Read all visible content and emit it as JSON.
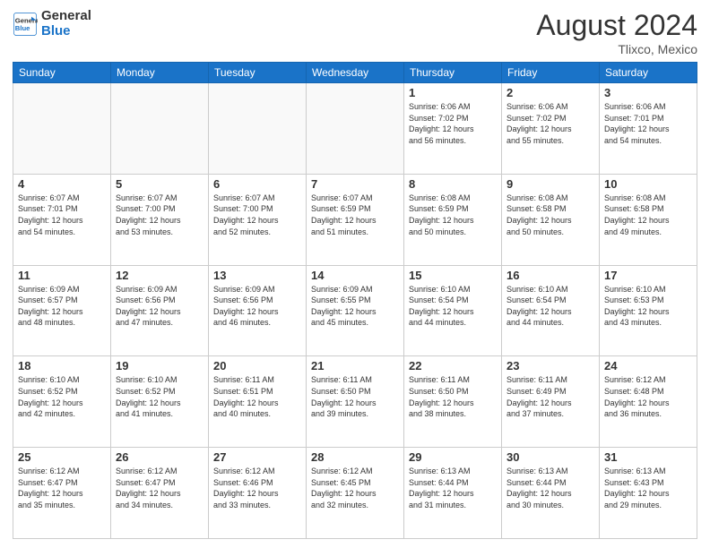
{
  "header": {
    "logo_line1": "General",
    "logo_line2": "Blue",
    "month_title": "August 2024",
    "location": "Tlixco, Mexico"
  },
  "weekdays": [
    "Sunday",
    "Monday",
    "Tuesday",
    "Wednesday",
    "Thursday",
    "Friday",
    "Saturday"
  ],
  "rows": [
    [
      {
        "day": "",
        "info": ""
      },
      {
        "day": "",
        "info": ""
      },
      {
        "day": "",
        "info": ""
      },
      {
        "day": "",
        "info": ""
      },
      {
        "day": "1",
        "info": "Sunrise: 6:06 AM\nSunset: 7:02 PM\nDaylight: 12 hours\nand 56 minutes."
      },
      {
        "day": "2",
        "info": "Sunrise: 6:06 AM\nSunset: 7:02 PM\nDaylight: 12 hours\nand 55 minutes."
      },
      {
        "day": "3",
        "info": "Sunrise: 6:06 AM\nSunset: 7:01 PM\nDaylight: 12 hours\nand 54 minutes."
      }
    ],
    [
      {
        "day": "4",
        "info": "Sunrise: 6:07 AM\nSunset: 7:01 PM\nDaylight: 12 hours\nand 54 minutes."
      },
      {
        "day": "5",
        "info": "Sunrise: 6:07 AM\nSunset: 7:00 PM\nDaylight: 12 hours\nand 53 minutes."
      },
      {
        "day": "6",
        "info": "Sunrise: 6:07 AM\nSunset: 7:00 PM\nDaylight: 12 hours\nand 52 minutes."
      },
      {
        "day": "7",
        "info": "Sunrise: 6:07 AM\nSunset: 6:59 PM\nDaylight: 12 hours\nand 51 minutes."
      },
      {
        "day": "8",
        "info": "Sunrise: 6:08 AM\nSunset: 6:59 PM\nDaylight: 12 hours\nand 50 minutes."
      },
      {
        "day": "9",
        "info": "Sunrise: 6:08 AM\nSunset: 6:58 PM\nDaylight: 12 hours\nand 50 minutes."
      },
      {
        "day": "10",
        "info": "Sunrise: 6:08 AM\nSunset: 6:58 PM\nDaylight: 12 hours\nand 49 minutes."
      }
    ],
    [
      {
        "day": "11",
        "info": "Sunrise: 6:09 AM\nSunset: 6:57 PM\nDaylight: 12 hours\nand 48 minutes."
      },
      {
        "day": "12",
        "info": "Sunrise: 6:09 AM\nSunset: 6:56 PM\nDaylight: 12 hours\nand 47 minutes."
      },
      {
        "day": "13",
        "info": "Sunrise: 6:09 AM\nSunset: 6:56 PM\nDaylight: 12 hours\nand 46 minutes."
      },
      {
        "day": "14",
        "info": "Sunrise: 6:09 AM\nSunset: 6:55 PM\nDaylight: 12 hours\nand 45 minutes."
      },
      {
        "day": "15",
        "info": "Sunrise: 6:10 AM\nSunset: 6:54 PM\nDaylight: 12 hours\nand 44 minutes."
      },
      {
        "day": "16",
        "info": "Sunrise: 6:10 AM\nSunset: 6:54 PM\nDaylight: 12 hours\nand 44 minutes."
      },
      {
        "day": "17",
        "info": "Sunrise: 6:10 AM\nSunset: 6:53 PM\nDaylight: 12 hours\nand 43 minutes."
      }
    ],
    [
      {
        "day": "18",
        "info": "Sunrise: 6:10 AM\nSunset: 6:52 PM\nDaylight: 12 hours\nand 42 minutes."
      },
      {
        "day": "19",
        "info": "Sunrise: 6:10 AM\nSunset: 6:52 PM\nDaylight: 12 hours\nand 41 minutes."
      },
      {
        "day": "20",
        "info": "Sunrise: 6:11 AM\nSunset: 6:51 PM\nDaylight: 12 hours\nand 40 minutes."
      },
      {
        "day": "21",
        "info": "Sunrise: 6:11 AM\nSunset: 6:50 PM\nDaylight: 12 hours\nand 39 minutes."
      },
      {
        "day": "22",
        "info": "Sunrise: 6:11 AM\nSunset: 6:50 PM\nDaylight: 12 hours\nand 38 minutes."
      },
      {
        "day": "23",
        "info": "Sunrise: 6:11 AM\nSunset: 6:49 PM\nDaylight: 12 hours\nand 37 minutes."
      },
      {
        "day": "24",
        "info": "Sunrise: 6:12 AM\nSunset: 6:48 PM\nDaylight: 12 hours\nand 36 minutes."
      }
    ],
    [
      {
        "day": "25",
        "info": "Sunrise: 6:12 AM\nSunset: 6:47 PM\nDaylight: 12 hours\nand 35 minutes."
      },
      {
        "day": "26",
        "info": "Sunrise: 6:12 AM\nSunset: 6:47 PM\nDaylight: 12 hours\nand 34 minutes."
      },
      {
        "day": "27",
        "info": "Sunrise: 6:12 AM\nSunset: 6:46 PM\nDaylight: 12 hours\nand 33 minutes."
      },
      {
        "day": "28",
        "info": "Sunrise: 6:12 AM\nSunset: 6:45 PM\nDaylight: 12 hours\nand 32 minutes."
      },
      {
        "day": "29",
        "info": "Sunrise: 6:13 AM\nSunset: 6:44 PM\nDaylight: 12 hours\nand 31 minutes."
      },
      {
        "day": "30",
        "info": "Sunrise: 6:13 AM\nSunset: 6:44 PM\nDaylight: 12 hours\nand 30 minutes."
      },
      {
        "day": "31",
        "info": "Sunrise: 6:13 AM\nSunset: 6:43 PM\nDaylight: 12 hours\nand 29 minutes."
      }
    ]
  ]
}
